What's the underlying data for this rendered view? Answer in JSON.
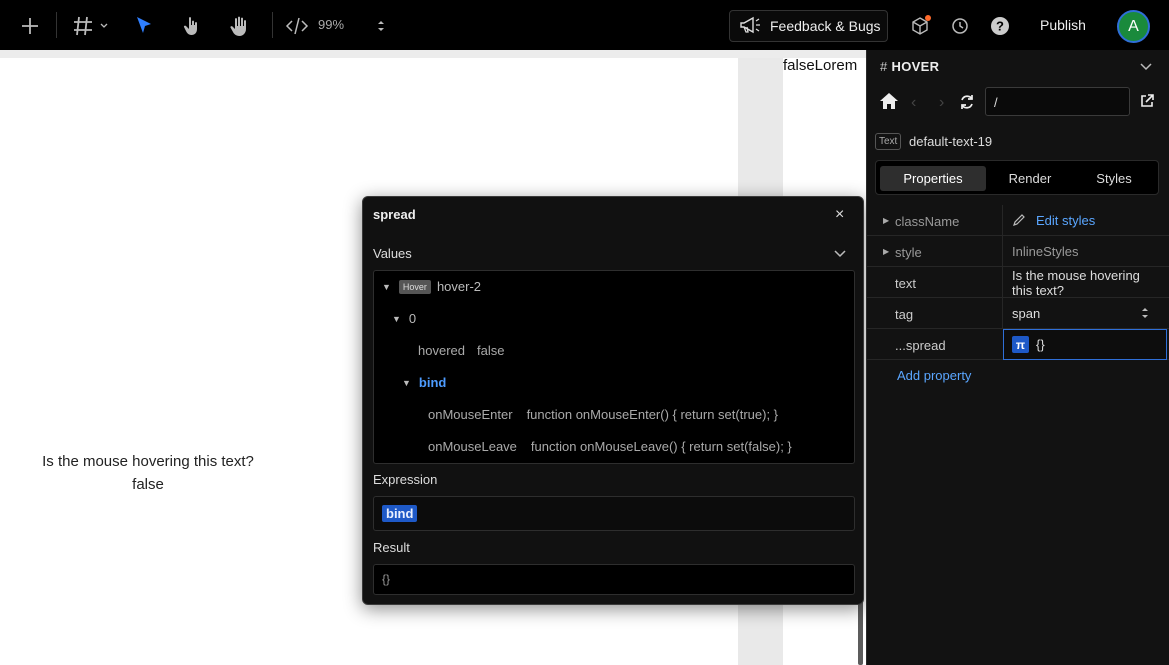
{
  "toolbar": {
    "zoom": "99%",
    "feedback_label": "Feedback & Bugs",
    "publish_label": "Publish",
    "avatar_initial": "A"
  },
  "canvas": {
    "top_right_text": "falseLorem",
    "hover_question": "Is the mouse hovering this text?",
    "hover_value": "false"
  },
  "popup": {
    "title": "spread",
    "close": "×",
    "values_label": "Values",
    "tree": {
      "root_badge": "Hover",
      "root_name": "hover-2",
      "index": "0",
      "hovered_key": "hovered",
      "hovered_value": "false",
      "bind_key": "bind",
      "enter_key": "onMouseEnter",
      "enter_value": "function onMouseEnter() { return set(true); }",
      "leave_key": "onMouseLeave",
      "leave_value": "function onMouseLeave() { return set(false); }"
    },
    "expression_label": "Expression",
    "expression_value": "bind",
    "result_label": "Result",
    "result_value": "{}"
  },
  "panel": {
    "title": "HOVER",
    "url": "/",
    "node_type": "Text",
    "node_name": "default-text-19",
    "tabs": [
      "Properties",
      "Render",
      "Styles"
    ],
    "props": {
      "className_label": "className",
      "className_value": "Edit styles",
      "style_label": "style",
      "style_value": "InlineStyles",
      "text_label": "text",
      "text_value": "Is the mouse hovering this text?",
      "tag_label": "tag",
      "tag_value": "span",
      "spread_label": "...spread",
      "spread_badge": "π",
      "spread_value": "{}"
    },
    "add_property": "Add property"
  },
  "colors": {
    "accent_blue": "#2f6fd8",
    "link_blue": "#5aa6ff",
    "avatar_green": "#1a8a3c",
    "notify_orange": "#ff6a2b"
  }
}
